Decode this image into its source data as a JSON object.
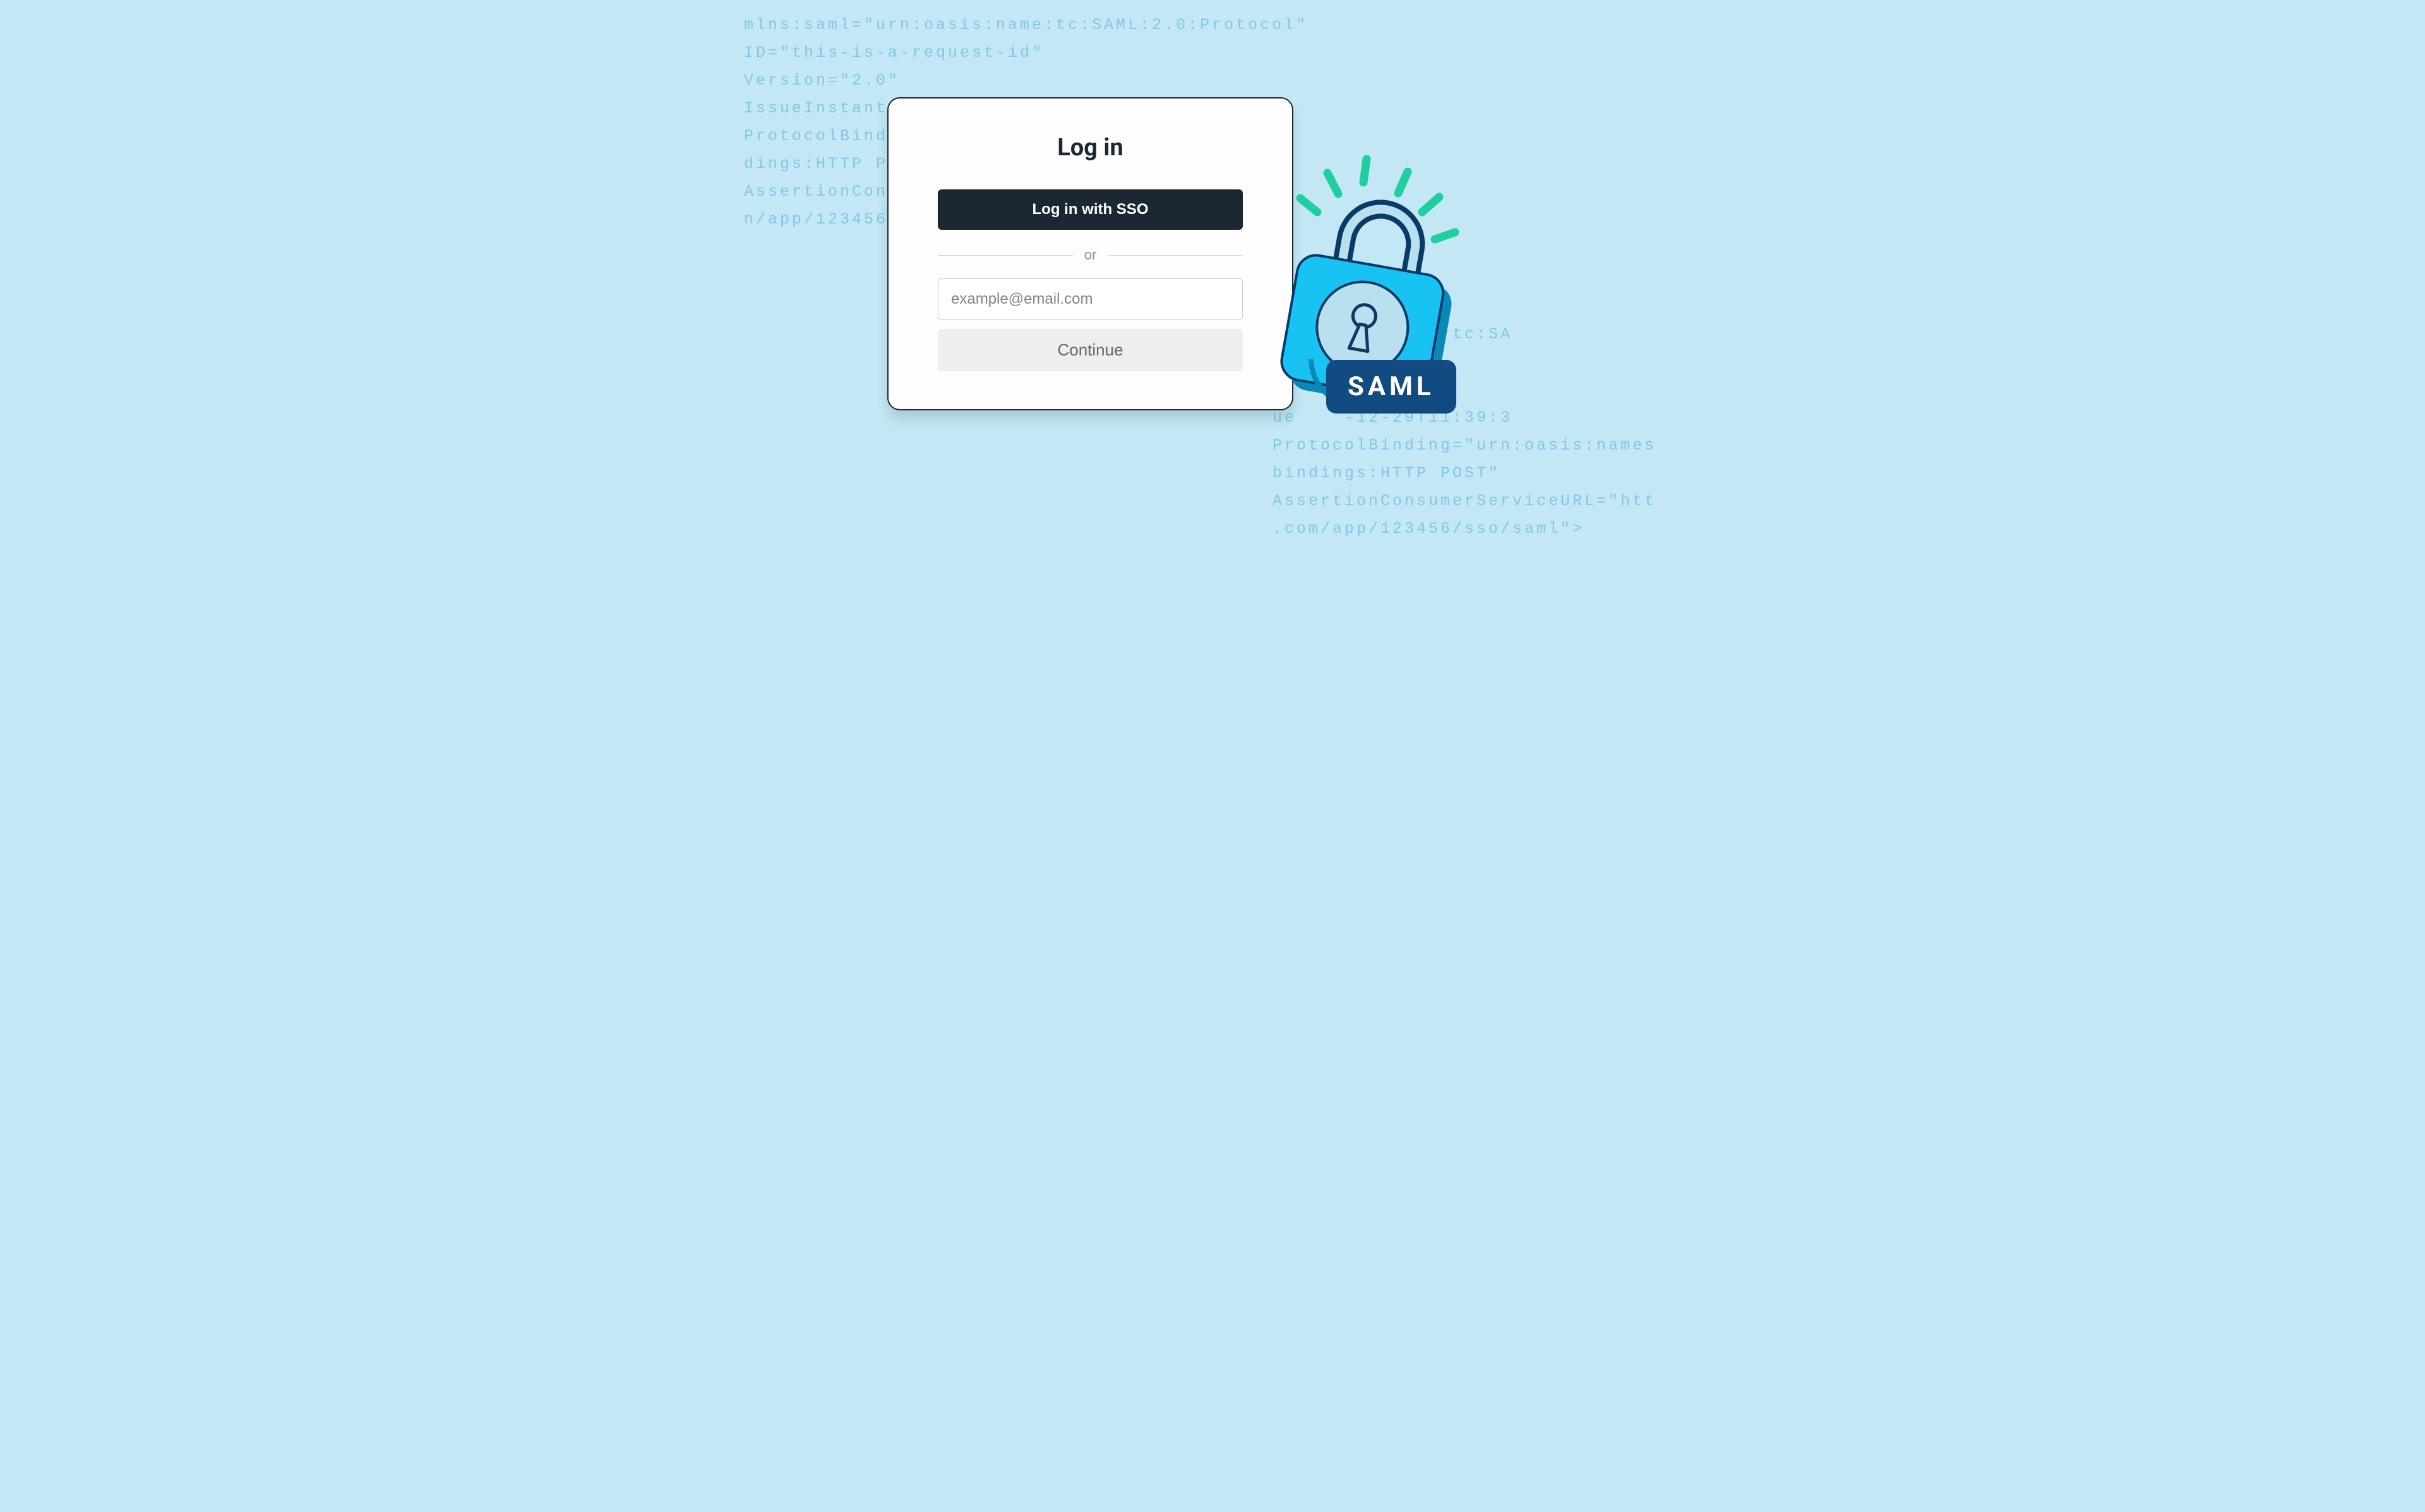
{
  "card": {
    "title": "Log in",
    "sso_button": "Log in with SSO",
    "divider": "or",
    "email_placeholder": "example@email.com",
    "continue_button": "Continue"
  },
  "badge": {
    "label": "SAML"
  },
  "code_left": "mlns:saml=\"urn:oasis:name:tc:SAML:2.0:Protocol\"\nID=\"this-is-a-request-id\"\nVersion=\"2.0\"\nIssueInstant=\"2022-12-29T11:39:34Z\"\nProtocolBinding=\"urn:oasis:names\ndings:HTTP POST\"\nAssertionConsumerServiceURL=\"htt\nn/app/123456/sso/saml\">",
  "code_right": "uest\nurn:oasis:name:tc:SA\na-request-id\"\n\nue    -12-29T11:39:3\nProtocolBinding=\"urn:oasis:names\nbindings:HTTP POST\"\nAssertionConsumerServiceURL=\"htt\n.com/app/123456/sso/saml\">"
}
